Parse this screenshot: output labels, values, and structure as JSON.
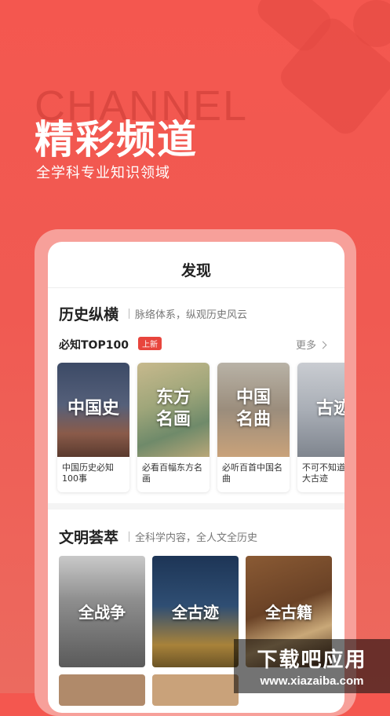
{
  "hero": {
    "watermark": "CHANNEL",
    "title": "精彩频道",
    "subtitle": "全学科专业知识领域"
  },
  "nav": {
    "title": "发现"
  },
  "history": {
    "title": "历史纵横",
    "subtitle": "脉络体系，纵观历史风云",
    "top_label": "必知TOP100",
    "badge": "上新",
    "more": "更多",
    "cards": [
      {
        "cover_line1": "中国史",
        "cover_line2": "",
        "caption": "中国历史必知100事"
      },
      {
        "cover_line1": "东方",
        "cover_line2": "名画",
        "caption": "必看百幅东方名画"
      },
      {
        "cover_line1": "中国",
        "cover_line2": "名曲",
        "caption": "必听百首中国名曲"
      },
      {
        "cover_line1": "古迹",
        "cover_line2": "",
        "caption": "不可不知道的百大古迹"
      }
    ]
  },
  "civilization": {
    "title": "文明荟萃",
    "subtitle": "全科学内容，全人文全历史",
    "tiles": [
      {
        "label": "全战争"
      },
      {
        "label": "全古迹"
      },
      {
        "label": "全古籍"
      }
    ]
  },
  "site_watermark": {
    "line1": "下载吧应用",
    "line2": "www.xiazaiba.com"
  },
  "colors": {
    "brand_red": "#f4574f",
    "badge_red": "#e8453d"
  }
}
